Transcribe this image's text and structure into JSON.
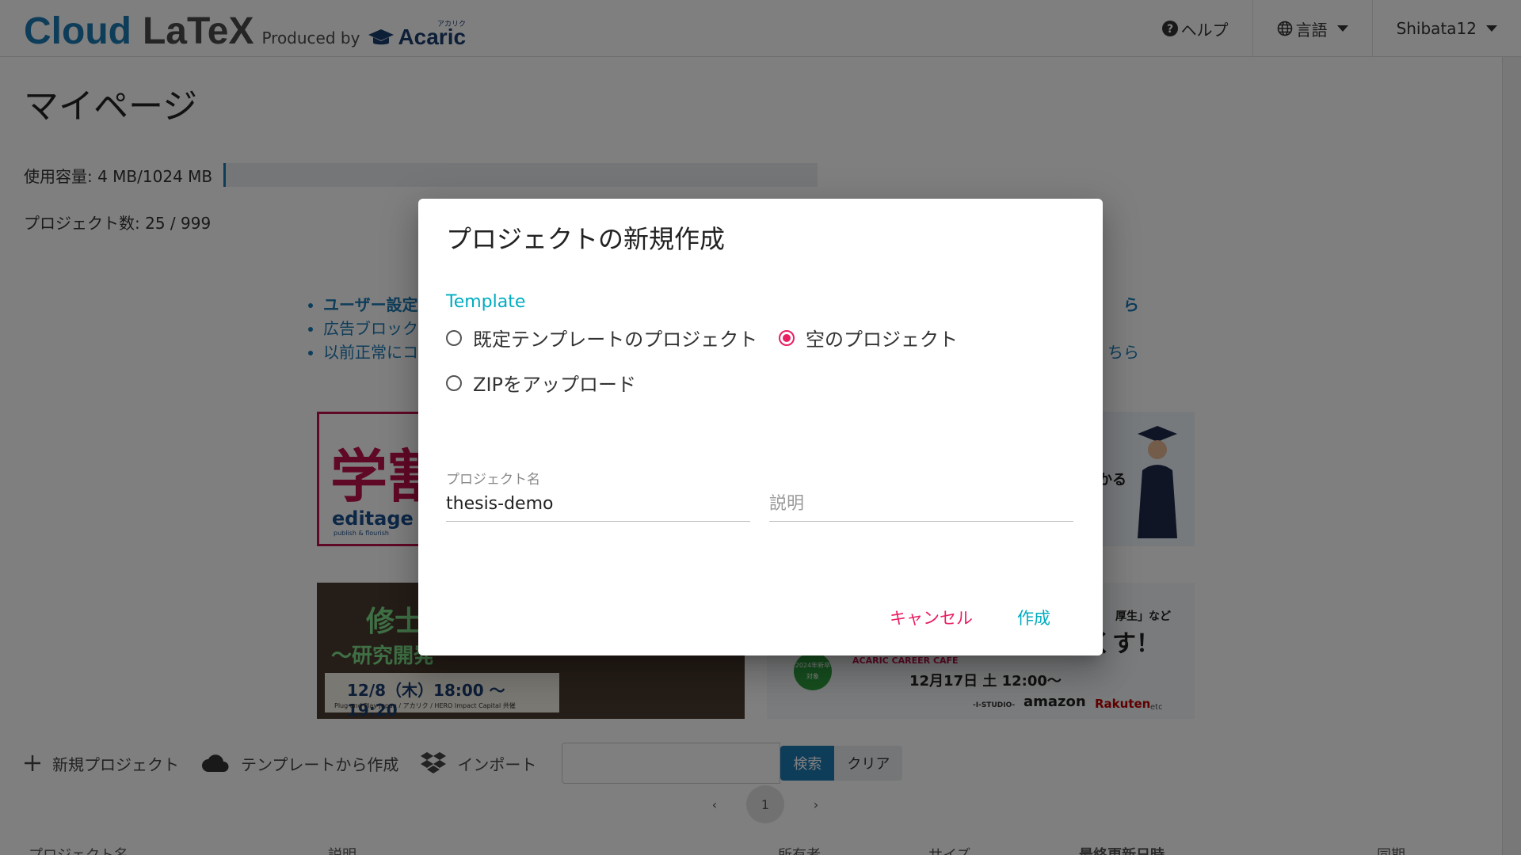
{
  "brand": {
    "cloud": "Cloud",
    "latex": "LaTeX",
    "produced_by": "Produced by",
    "acaric": "Acaric",
    "acaric_kana": "アカリク"
  },
  "nav": {
    "help": "ヘルプ",
    "language": "言語",
    "user": "Shibata12"
  },
  "page": {
    "title": "マイページ",
    "usage_label": "使用容量: 4 MB/1024 MB",
    "usage_fraction": 0.004,
    "projects_label": "プロジェクト数: 25 / 999"
  },
  "notices": [
    {
      "text": "ユーザー設定",
      "tail": "ら"
    },
    {
      "text": "広告ブロック",
      "tail": ""
    },
    {
      "text": "以前正常にコ",
      "tail": "ちら"
    }
  ],
  "banners": {
    "editage_big": "学割",
    "editage_logo": "editage",
    "editage_sub": "publish & flourish",
    "b2_text": "かる",
    "seminar_title": "修士",
    "seminar_sub": "～研究開発",
    "seminar_date": "12/8（木）18:00 〜 19:20",
    "seminar_sponsor": "Plug and Play Japan / アカリク / HERO Impact Capital 共催",
    "career_quote": "厚生」など",
    "career_big": "くす！",
    "career_badge": "2024年新卒対象",
    "career_cafe": "ACARIC CAREER CAFE",
    "career_when": "12月17日 土 12:00〜",
    "career_amazon": "amazon",
    "career_rakuten": "Rakuten",
    "career_etc": "etc",
    "career_studio": "-I-STUDIO-"
  },
  "toolbar": {
    "new_project": "新規プロジェクト",
    "from_template": "テンプレートから作成",
    "import": "インポート",
    "search_button": "検索",
    "clear_button": "クリア"
  },
  "pager": {
    "prev": "‹",
    "page": "1",
    "next": "›"
  },
  "table_headers": {
    "name": "プロジェクト名",
    "description": "説明",
    "owner": "所有者",
    "size": "サイズ",
    "updated": "最終更新日時",
    "sync": "同期"
  },
  "dialog": {
    "title": "プロジェクトの新規作成",
    "template_label": "Template",
    "options": {
      "default_template": "既定テンプレートのプロジェクト",
      "empty_project": "空のプロジェクト",
      "zip_upload": "ZIPをアップロード"
    },
    "selected": "empty_project",
    "name_label": "プロジェクト名",
    "name_value": "thesis-demo",
    "description_placeholder": "説明",
    "cancel": "キャンセル",
    "create": "作成"
  },
  "colors": {
    "brand_blue": "#1d7ab5",
    "accent_pink": "#e91e63",
    "accent_cyan": "#00acc1"
  }
}
